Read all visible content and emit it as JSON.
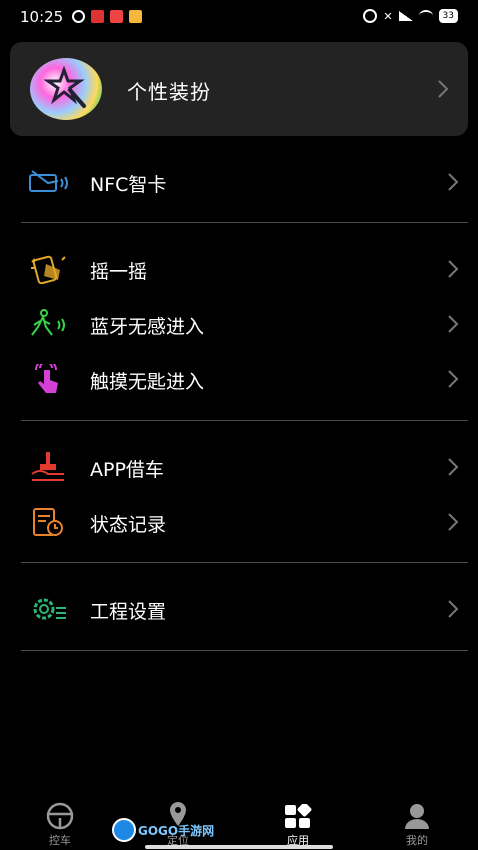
{
  "status_bar": {
    "time": "10:25",
    "battery": "33"
  },
  "header_card": {
    "label": "个性装扮"
  },
  "menu": {
    "nfc": "NFC智卡",
    "shake": "摇一摇",
    "bluetooth": "蓝牙无感进入",
    "touch": "触摸无匙进入",
    "app_borrow": "APP借车",
    "status_log": "状态记录",
    "engineering": "工程设置"
  },
  "tabs": {
    "control": "控车",
    "locate": "定位",
    "apps": "应用",
    "mine": "我的"
  },
  "watermark": {
    "text": "GOGO手游网"
  },
  "colors": {
    "accent_blue": "#3b8fd6",
    "accent_yellow": "#e3a928",
    "accent_green": "#35d44a",
    "accent_pink": "#d63fd6",
    "accent_red": "#e23b2e",
    "accent_orange": "#e8832a",
    "accent_teal": "#2bb673"
  }
}
